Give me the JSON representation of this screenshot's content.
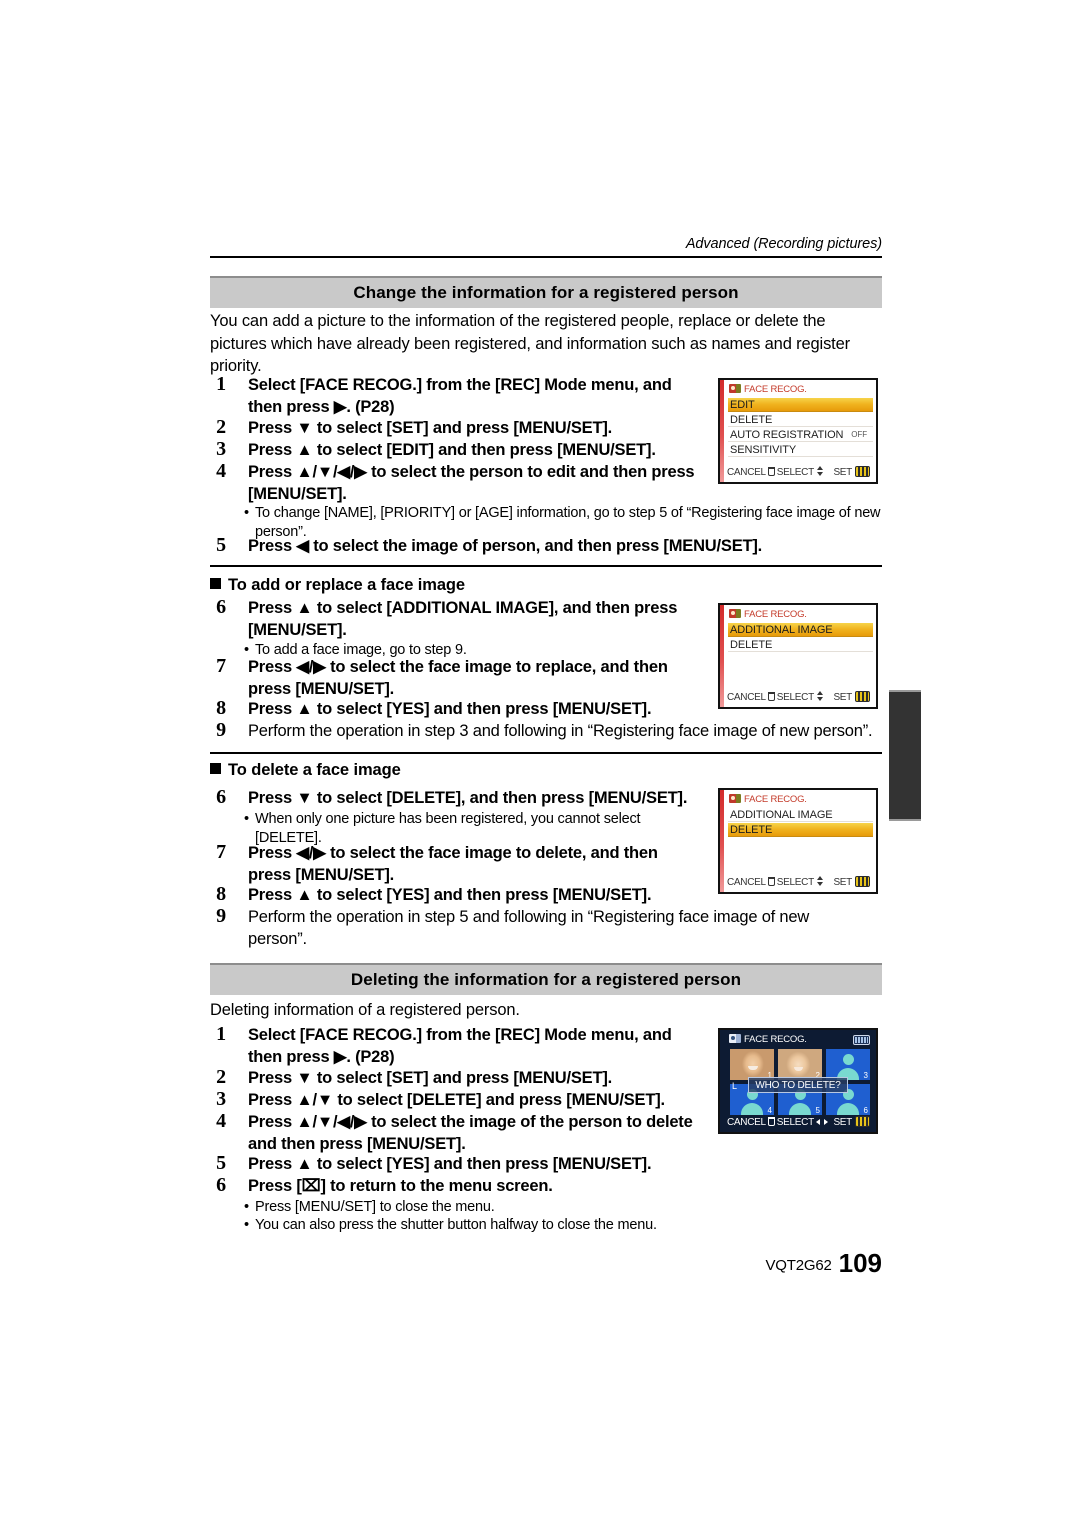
{
  "running_head": "Advanced (Recording pictures)",
  "sections": [
    {
      "heading": "Change the information for a registered person",
      "intro": "You can add a picture to the information of the registered people, replace or delete the pictures which have already been registered, and information such as names and register priority.",
      "steps": [
        {
          "num": "1",
          "text": "Select [FACE RECOG.] from the [REC] Mode menu, and then press ▶. (P28)"
        },
        {
          "num": "2",
          "text": "Press ▼ to select [SET] and press [MENU/SET]."
        },
        {
          "num": "3",
          "text": "Press ▲ to select [EDIT] and then press [MENU/SET]."
        },
        {
          "num": "4",
          "text": "Press ▲/▼/◀/▶ to select the person to edit and then press [MENU/SET]."
        }
      ],
      "bullet1": "To change [NAME], [PRIORITY] or [AGE] information, go to step 5 of “Registering face image of new person”.",
      "bullet1_big": "5",
      "step5": {
        "num": "5",
        "text": "Press ◀ to select the image of person, and then press [MENU/SET]."
      }
    }
  ],
  "add_replace": {
    "heading": "To add or replace a face image",
    "step6": {
      "num": "6",
      "text": "Press ▲ to select [ADDITIONAL IMAGE], and then press [MENU/SET]."
    },
    "bullet": "To add a face image, go to step 9.",
    "bullet_big": "9",
    "step7": {
      "num": "7",
      "text": "Press ◀/▶ to select the face image to replace, and then press [MENU/SET]."
    },
    "step8": {
      "num": "8",
      "text": "Press ▲ to select [YES] and then press [MENU/SET]."
    },
    "step9": {
      "num": "9",
      "text": "Perform the operation in step 3 and following in “Registering face image of new person”.",
      "inline_big": "3"
    }
  },
  "delete_face": {
    "heading": "To delete a face image",
    "step6": {
      "num": "6",
      "text": "Press ▼ to select [DELETE], and then press [MENU/SET]."
    },
    "bullet": "When only one picture has been registered, you cannot select [DELETE].",
    "step7": {
      "num": "7",
      "text": "Press ◀/▶ to select the face image to delete, and then press [MENU/SET]."
    },
    "step8": {
      "num": "8",
      "text": "Press ▲ to select [YES] and then press [MENU/SET]."
    },
    "step9": {
      "num": "9",
      "text": "Perform the operation in step 5 and following in “Registering face image of new person”.",
      "inline_big": "5"
    }
  },
  "delete_person": {
    "heading": "Deleting the information for a registered person",
    "intro": "Deleting information of a registered person.",
    "steps": [
      {
        "num": "1",
        "text": "Select [FACE RECOG.] from the [REC] Mode menu, and then press ▶. (P28)"
      },
      {
        "num": "2",
        "text": "Press ▼ to select [SET] and press [MENU/SET]."
      },
      {
        "num": "3",
        "text": "Press ▲/▼ to select [DELETE] and press [MENU/SET]."
      },
      {
        "num": "4",
        "text": "Press ▲/▼/◀/▶ to select the image of the person to delete and then press [MENU/SET]."
      },
      {
        "num": "5",
        "text": "Press ▲ to select [YES] and then press [MENU/SET]."
      },
      {
        "num": "6",
        "text": "Press [⌧] to return to the menu screen."
      }
    ],
    "bullets": [
      "Press [MENU/SET] to close the menu.",
      "You can also press the shutter button halfway to close the menu."
    ]
  },
  "lcd_menu_1": {
    "title": "FACE RECOG.",
    "rows": [
      {
        "label": "EDIT",
        "value": "",
        "selected": true
      },
      {
        "label": "DELETE",
        "value": "",
        "selected": false
      },
      {
        "label": "AUTO REGISTRATION",
        "value": "OFF",
        "selected": false
      },
      {
        "label": "SENSITIVITY",
        "value": "",
        "selected": false
      }
    ],
    "status_cancel": "CANCEL",
    "status_select": "SELECT",
    "status_set": "SET"
  },
  "lcd_menu_2": {
    "title": "FACE RECOG.",
    "rows": [
      {
        "label": "ADDITIONAL IMAGE",
        "value": "",
        "selected": true
      },
      {
        "label": "DELETE",
        "value": "",
        "selected": false
      }
    ],
    "status_cancel": "CANCEL",
    "status_select": "SELECT",
    "status_set": "SET"
  },
  "lcd_menu_3": {
    "title": "FACE RECOG.",
    "rows": [
      {
        "label": "ADDITIONAL IMAGE",
        "value": "",
        "selected": false
      },
      {
        "label": "DELETE",
        "value": "",
        "selected": true
      }
    ],
    "status_cancel": "CANCEL",
    "status_select": "SELECT",
    "status_set": "SET"
  },
  "lcd_faces": {
    "title": "FACE RECOG.",
    "prompt": "WHO TO DELETE?",
    "mode_badge": "L",
    "cells": [
      {
        "index": "1",
        "kind": "photo-girl",
        "selected": true
      },
      {
        "index": "2",
        "kind": "photo-child",
        "selected": false
      },
      {
        "index": "3",
        "kind": "silhouette",
        "selected": false
      },
      {
        "index": "4",
        "kind": "silhouette",
        "selected": false
      },
      {
        "index": "5",
        "kind": "silhouette",
        "selected": false
      },
      {
        "index": "6",
        "kind": "silhouette",
        "selected": false
      }
    ],
    "status_cancel": "CANCEL",
    "status_select": "SELECT",
    "status_set": "SET"
  },
  "footer": {
    "code": "VQT2G62",
    "page": "109"
  },
  "colors": {
    "section_bar": "#c9c9c9",
    "menu_highlight": "#f0b31f",
    "menu_title_red": "#c43b2a",
    "lcd_dark_bg": "#0d1b33"
  }
}
